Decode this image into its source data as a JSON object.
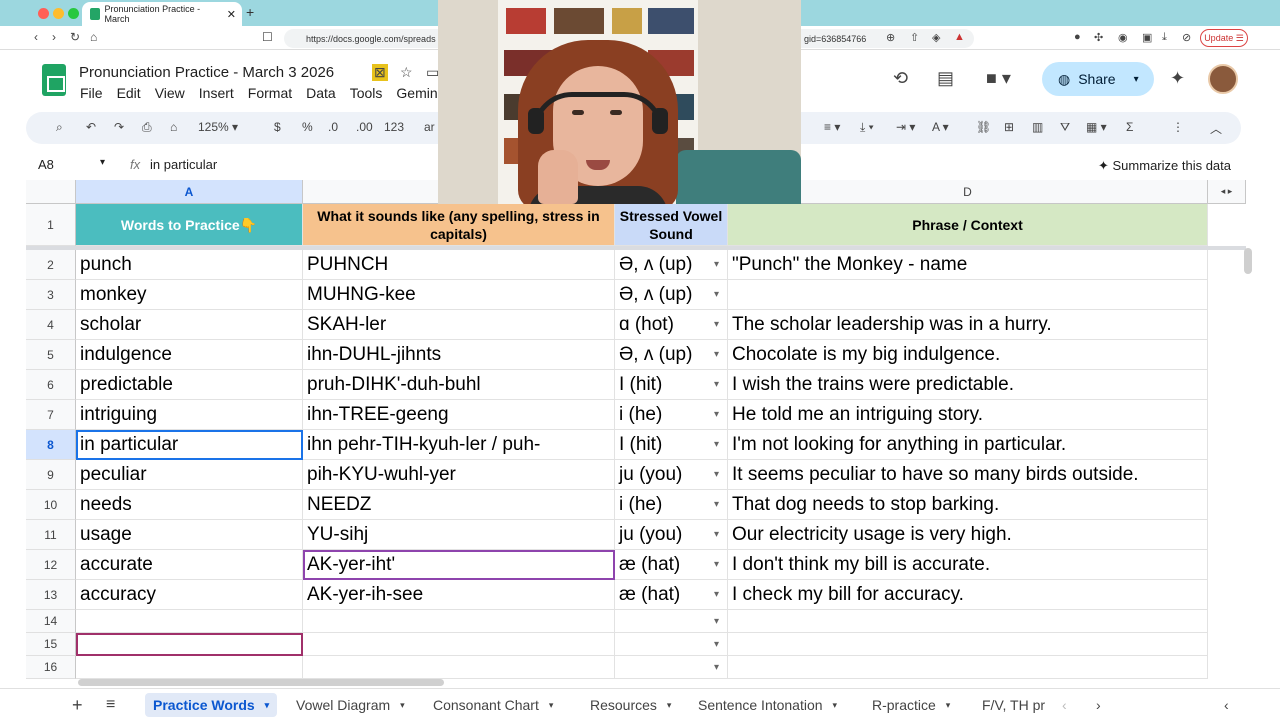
{
  "browser": {
    "tab_title": "Pronunciation Practice - March",
    "url": "https://docs.google.com/spreads",
    "url_suffix": "gid=636854766",
    "update_label": "Update"
  },
  "doc": {
    "title": "Pronunciation Practice - March 3 2026",
    "menu": [
      "File",
      "Edit",
      "View",
      "Insert",
      "Format",
      "Data",
      "Tools",
      "Gemini"
    ],
    "share_label": "Share"
  },
  "format_bar": {
    "zoom": "125%",
    "currency": "$",
    "percent": "%",
    "dec_decrease": ".0",
    "dec_increase": ".00",
    "number_format": "123",
    "font_stub": "ar"
  },
  "formula_bar": {
    "cell_ref": "A8",
    "fx": "fx",
    "value": "in particular",
    "summarize": "Summarize this data"
  },
  "columns": [
    "A",
    "",
    "",
    "D"
  ],
  "header_row": {
    "num": "1",
    "a": "Words to Practice👇",
    "b": "What it sounds like (any spelling, stress in capitals)",
    "c": "Stressed Vowel Sound",
    "d": "Phrase / Context"
  },
  "rows": [
    {
      "num": "2",
      "word": "punch",
      "sounds": "PUHNCH",
      "vowel": "Ə, ʌ (up)",
      "phrase": "\"Punch\" the Monkey - name"
    },
    {
      "num": "3",
      "word": "monkey",
      "sounds": "MUHNG-kee",
      "vowel": "Ə, ʌ (up)",
      "phrase": ""
    },
    {
      "num": "4",
      "word": "scholar",
      "sounds": "SKAH-ler",
      "vowel": "ɑ (hot)",
      "phrase": "The scholar leadership was in a hurry."
    },
    {
      "num": "5",
      "word": "indulgence",
      "sounds": "ihn-DUHL-jihnts",
      "vowel": "Ə, ʌ (up)",
      "phrase": "Chocolate is my big indulgence."
    },
    {
      "num": "6",
      "word": "predictable",
      "sounds": "pruh-DIHK'-duh-buhl",
      "vowel": "I (hit)",
      "phrase": "I wish the trains were predictable."
    },
    {
      "num": "7",
      "word": "intriguing",
      "sounds": "ihn-TREE-geeng",
      "vowel": "i (he)",
      "phrase": "He told me an intriguing story."
    },
    {
      "num": "8",
      "word": "in particular",
      "sounds": "ihn pehr-TIH-kyuh-ler / puh-",
      "vowel": "I (hit)",
      "phrase": "I'm not looking for anything in particular."
    },
    {
      "num": "9",
      "word": "peculiar",
      "sounds": "pih-KYU-wuhl-yer",
      "vowel": "ju (you)",
      "phrase": "It seems peculiar to have so many birds outside."
    },
    {
      "num": "10",
      "word": "needs",
      "sounds": "NEEDZ",
      "vowel": "i (he)",
      "phrase": "That dog needs to stop barking."
    },
    {
      "num": "11",
      "word": "usage",
      "sounds": "YU-sihj",
      "vowel": "ju (you)",
      "phrase": "Our electricity usage is very high."
    },
    {
      "num": "12",
      "word": "accurate",
      "sounds": "AK-yer-iht'",
      "vowel": "æ (hat)",
      "phrase": "I don't think my bill is accurate."
    },
    {
      "num": "13",
      "word": "accuracy",
      "sounds": "AK-yer-ih-see",
      "vowel": "æ (hat)",
      "phrase": "I check my bill for accuracy."
    },
    {
      "num": "14",
      "word": "",
      "sounds": "",
      "vowel": "",
      "phrase": ""
    },
    {
      "num": "15",
      "word": "",
      "sounds": "",
      "vowel": "",
      "phrase": ""
    },
    {
      "num": "16",
      "word": "",
      "sounds": "",
      "vowel": "",
      "phrase": ""
    }
  ],
  "sheet_tabs": [
    "Practice Words",
    "Vowel Diagram",
    "Consonant Chart",
    "Resources",
    "Sentence Intonation",
    "R-practice",
    "F/V, TH pr"
  ],
  "colors": {
    "header_a": "#4bbdbf",
    "header_b": "#f6c28d",
    "header_c": "#c9daf8",
    "header_d": "#d5e8c4",
    "accent": "#0b57d0"
  }
}
